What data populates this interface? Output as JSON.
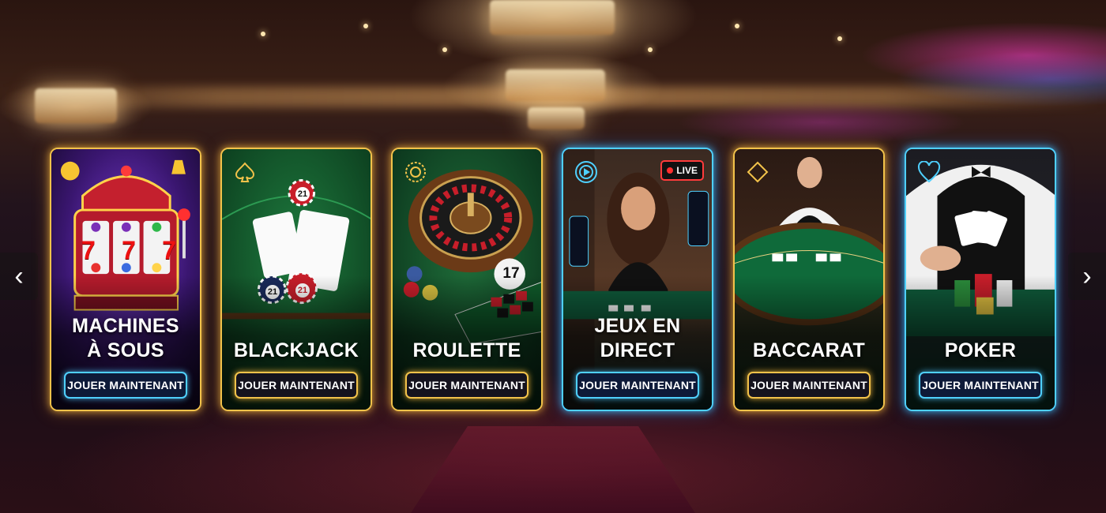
{
  "carousel": {
    "prev_label": "‹",
    "next_label": "›",
    "cards": [
      {
        "title_lines": [
          "MACHINES",
          "À SOUS"
        ],
        "button": "JOUER MAINTENANT",
        "icon": "slot-machine-icon",
        "border": "#f2c24a"
      },
      {
        "title_lines": [
          "BLACKJACK"
        ],
        "button": "JOUER MAINTENANT",
        "icon": "spade-icon",
        "border": "#f2c24a",
        "chip_label": "21"
      },
      {
        "title_lines": [
          "ROULETTE"
        ],
        "button": "JOUER MAINTENANT",
        "icon": "roulette-wheel-icon",
        "border": "#f2c24a",
        "ball_number": "17"
      },
      {
        "title_lines": [
          "JEUX EN",
          "DIRECT"
        ],
        "button": "JOUER MAINTENANT",
        "icon": "live-stream-icon",
        "border": "#4fd0ff",
        "badge": "LIVE"
      },
      {
        "title_lines": [
          "BACCARAT"
        ],
        "button": "JOUER MAINTENANT",
        "icon": "diamond-icon",
        "border": "#f2c24a"
      },
      {
        "title_lines": [
          "POKER"
        ],
        "button": "JOUER MAINTENANT",
        "icon": "heart-icon",
        "border": "#4fd0ff"
      }
    ]
  },
  "slot_reels": [
    "7",
    "7",
    "7"
  ],
  "colors": {
    "gold": "#f2c24a",
    "blue": "#4fd0ff",
    "live_red": "#ff3b3b"
  }
}
